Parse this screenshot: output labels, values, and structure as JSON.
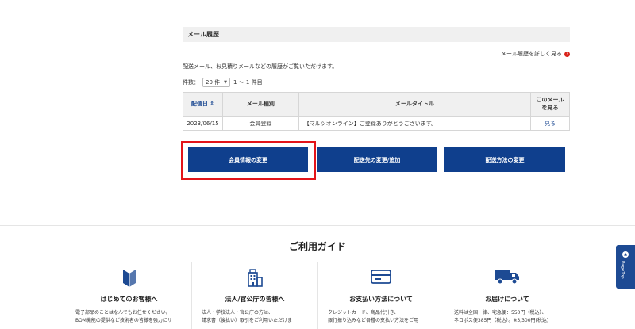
{
  "mail_history": {
    "heading": "メール履歴",
    "detail_link": "メール履歴を詳しく見る",
    "description": "配送メール、お見積りメールなどの履歴がご覧いただけます。",
    "count_label": "件数：",
    "count_value": "20 件",
    "range_text": "1 〜 1 件目",
    "table": {
      "headers": {
        "date": "配信日 ⇕",
        "type": "メール種別",
        "title": "メールタイトル",
        "view_line1": "このメール",
        "view_line2": "を見る"
      },
      "rows": [
        {
          "date": "2023/06/15",
          "type": "会員登録",
          "title": "【マルツオンライン】ご登録ありがとうございます。",
          "view": "見る"
        }
      ]
    }
  },
  "buttons": {
    "member_info": "会員情報の変更",
    "delivery_address": "配送先の変更/追加",
    "delivery_method": "配送方法の変更"
  },
  "guide": {
    "title": "ご利用ガイド",
    "columns": [
      {
        "icon": "beginner-mark-icon",
        "title": "はじめてのお客様へ",
        "line1": "電子部品のことはなんでもお任せください。",
        "line2": "BOM機能の提供など技術者の皆様を強力にサ"
      },
      {
        "icon": "building-icon",
        "title": "法人/官公庁の皆様へ",
        "line1": "法人・学校法人・官公庁の方は、",
        "line2": "請求書（後払い）取引をご利用いただけま"
      },
      {
        "icon": "credit-card-icon",
        "title": "お支払い方法について",
        "line1": "クレジットカード、商品代引き、",
        "line2": "銀行振り込みなど各種の支払い方法をご用"
      },
      {
        "icon": "truck-icon",
        "title": "お届けについて",
        "line1": "送料は全国一律、宅急便：550円（税込）、",
        "line2": "ネコポス便385円（税込）。※3,300円(税込)"
      }
    ]
  },
  "pagetop": {
    "label": "PageTop"
  },
  "colors": {
    "brand_blue": "#0f3f8d",
    "link_blue": "#1d4a93",
    "highlight_red": "#e3141a"
  }
}
